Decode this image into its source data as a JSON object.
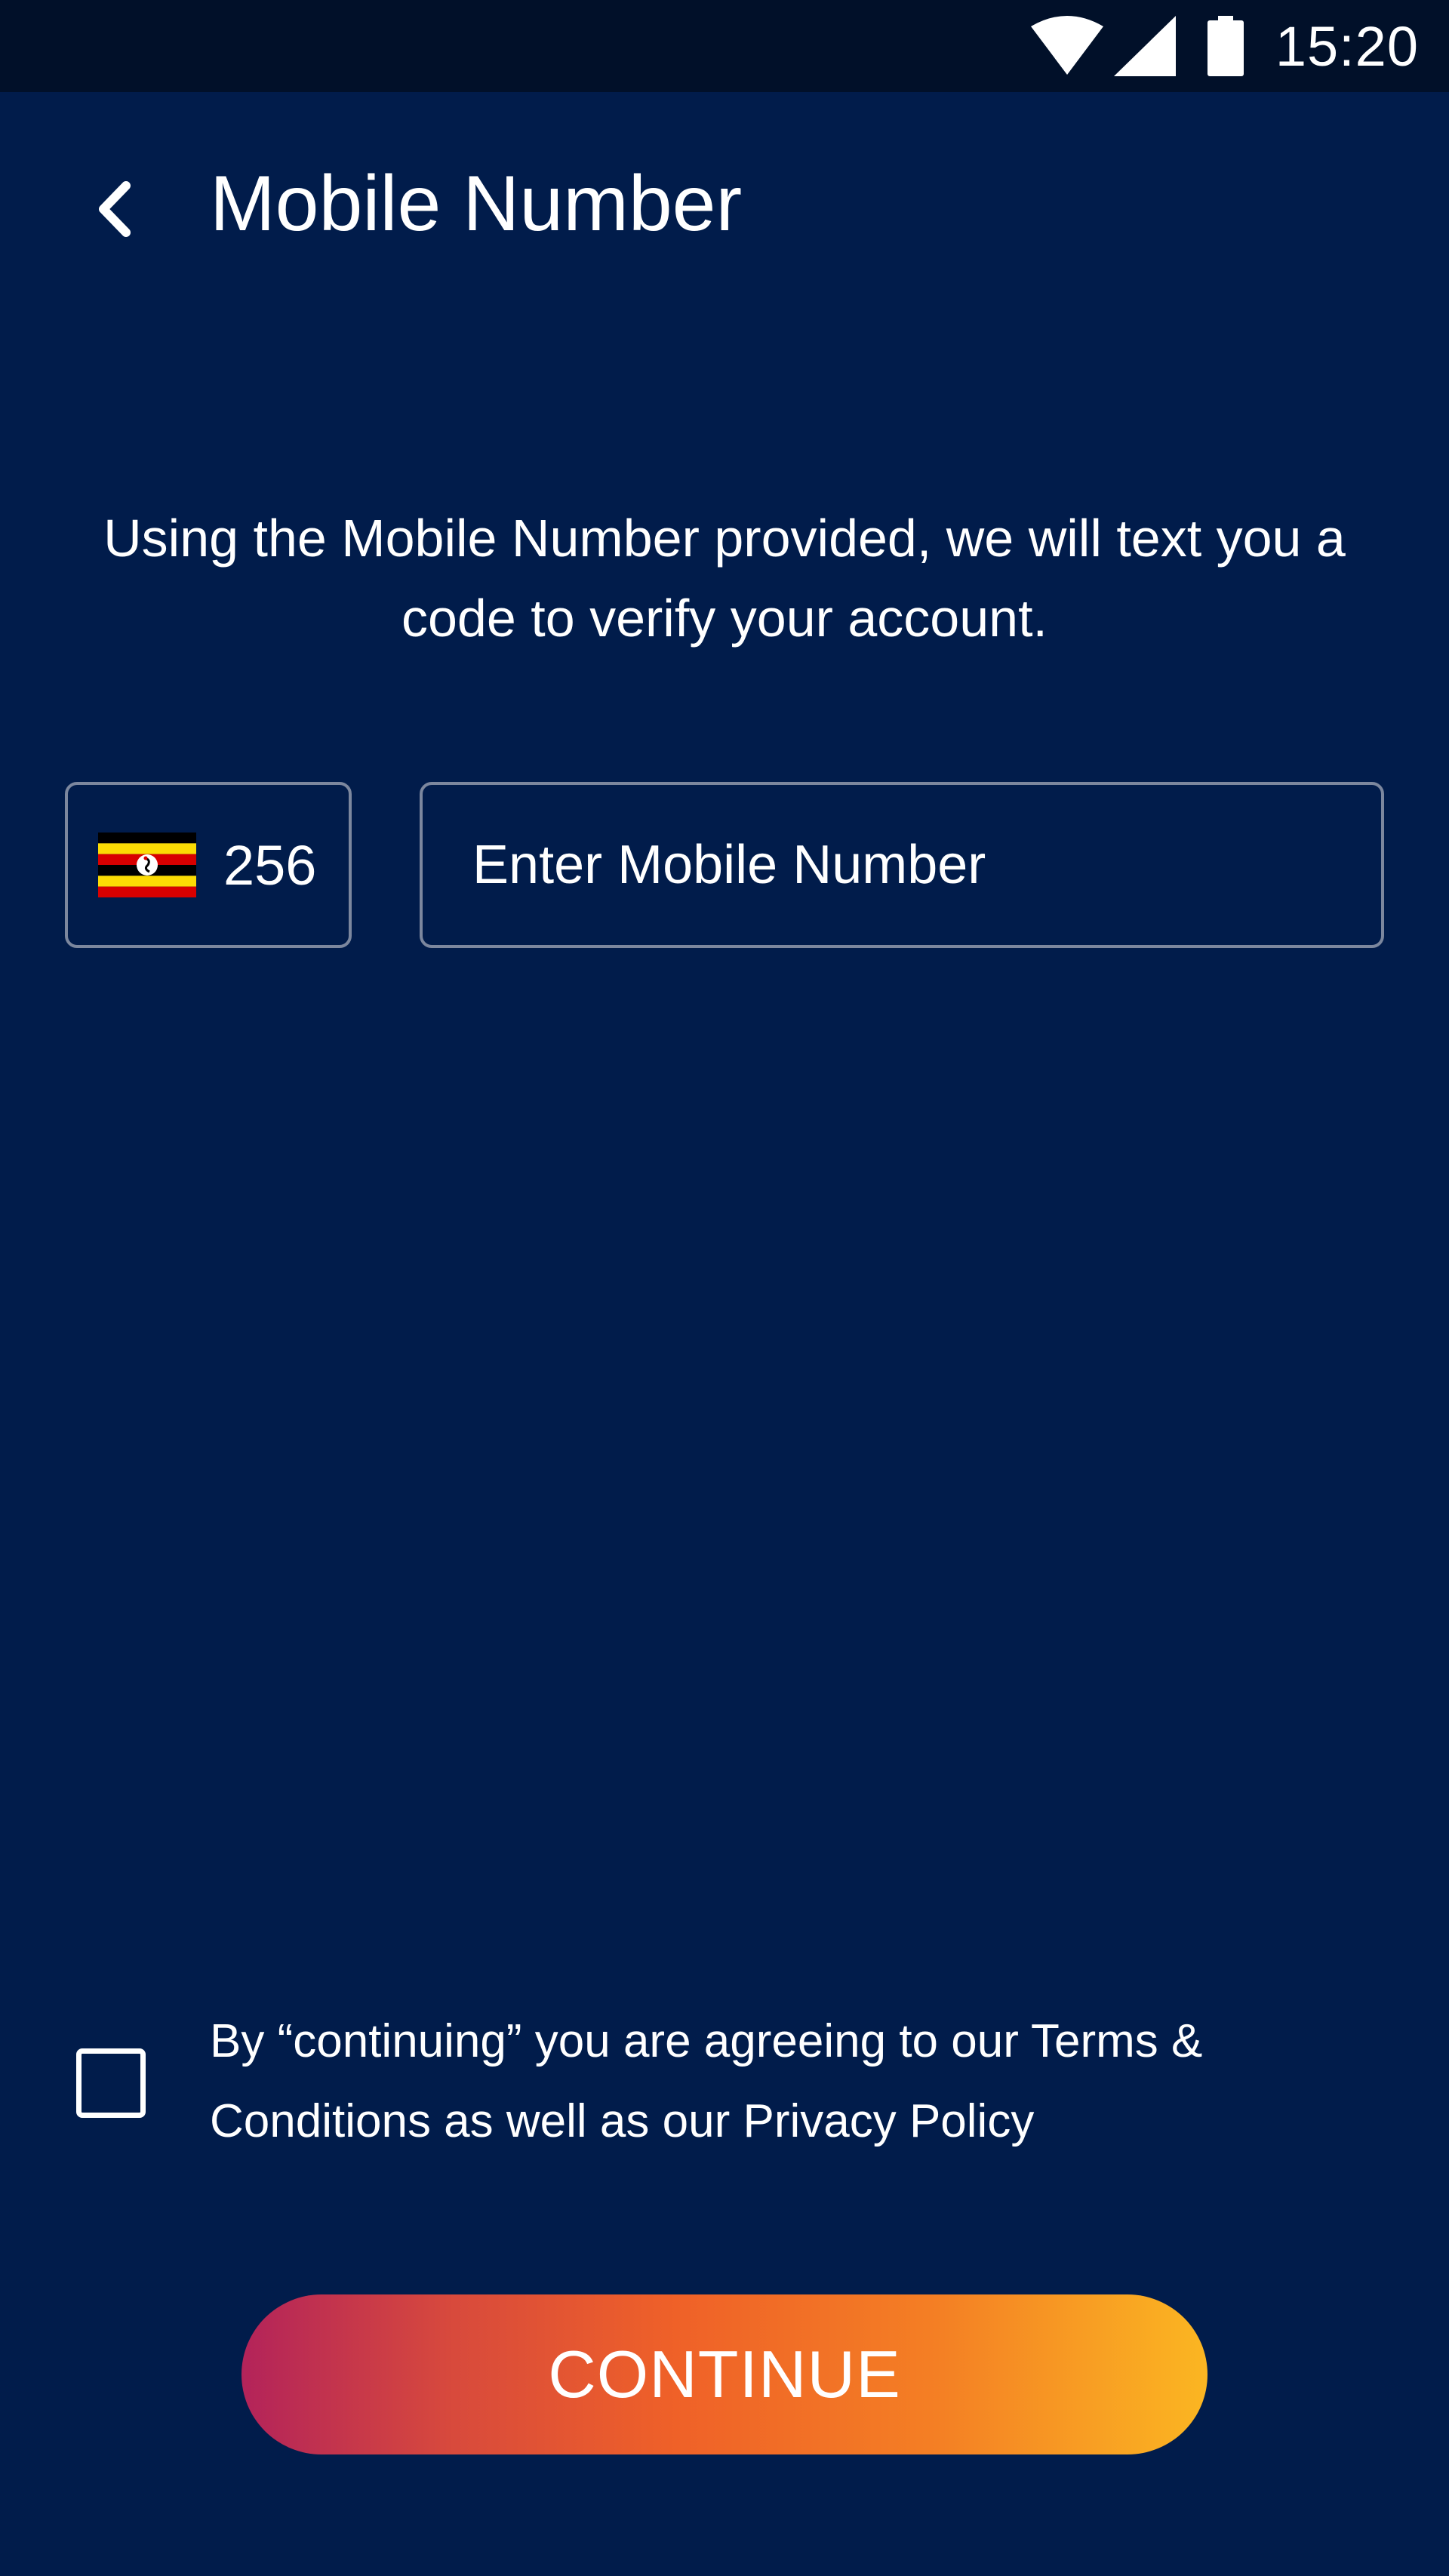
{
  "status_bar": {
    "time": "15:20",
    "icons": [
      "wifi-icon",
      "cellular-signal-icon",
      "battery-icon"
    ]
  },
  "header": {
    "back_icon": "chevron-left-icon",
    "title": "Mobile Number"
  },
  "instructions": "Using the Mobile Number provided, we will text you a code to verify your account.",
  "country_picker": {
    "flag": "uganda-flag-icon",
    "code": "256"
  },
  "mobile_input": {
    "value": "",
    "placeholder": "Enter Mobile Number"
  },
  "terms": {
    "checked": false,
    "text": "By “continuing” you are agreeing to our Terms & Conditions as well as our Privacy Policy"
  },
  "continue_button": {
    "label": "CONTINUE"
  },
  "colors": {
    "background": "#011c4b",
    "status_bar": "#011029",
    "field_border": "#7c879e",
    "button_gradient_start": "#b3235a",
    "button_gradient_end": "#fbb622"
  }
}
